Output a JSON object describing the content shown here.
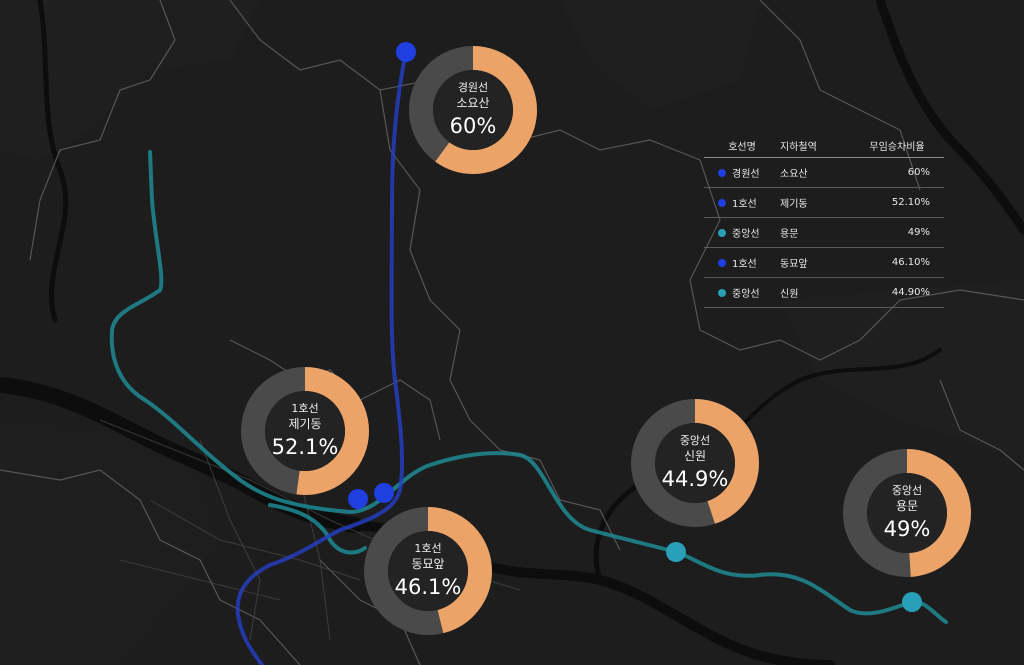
{
  "colors": {
    "background": "#1c1c1c",
    "line1": "#1f3fe0",
    "jungang": "#2a9fb8",
    "donut_fill": "#eba368",
    "donut_track": "#4a4a4a"
  },
  "donuts": [
    {
      "line": "경원선",
      "station": "소요산",
      "percent_label": "60%",
      "value": 60
    },
    {
      "line": "1호선",
      "station": "제기동",
      "percent_label": "52.1%",
      "value": 52.1
    },
    {
      "line": "1호선",
      "station": "동묘앞",
      "percent_label": "46.1%",
      "value": 46.1
    },
    {
      "line": "중앙선",
      "station": "신원",
      "percent_label": "44.9%",
      "value": 44.9
    },
    {
      "line": "중앙선",
      "station": "용문",
      "percent_label": "49%",
      "value": 49
    }
  ],
  "table": {
    "headers": [
      "호선명",
      "지하철역",
      "무임승차비율"
    ],
    "rows": [
      {
        "line": "경원선",
        "station": "소요산",
        "ratio": "60%",
        "dot_color": "#1f3fe0"
      },
      {
        "line": "1호선",
        "station": "제기동",
        "ratio": "52.10%",
        "dot_color": "#1f3fe0"
      },
      {
        "line": "중앙선",
        "station": "용문",
        "ratio": "49%",
        "dot_color": "#2a9fb8"
      },
      {
        "line": "1호선",
        "station": "동묘앞",
        "ratio": "46.10%",
        "dot_color": "#1f3fe0"
      },
      {
        "line": "중앙선",
        "station": "신원",
        "ratio": "44.90%",
        "dot_color": "#2a9fb8"
      }
    ]
  }
}
